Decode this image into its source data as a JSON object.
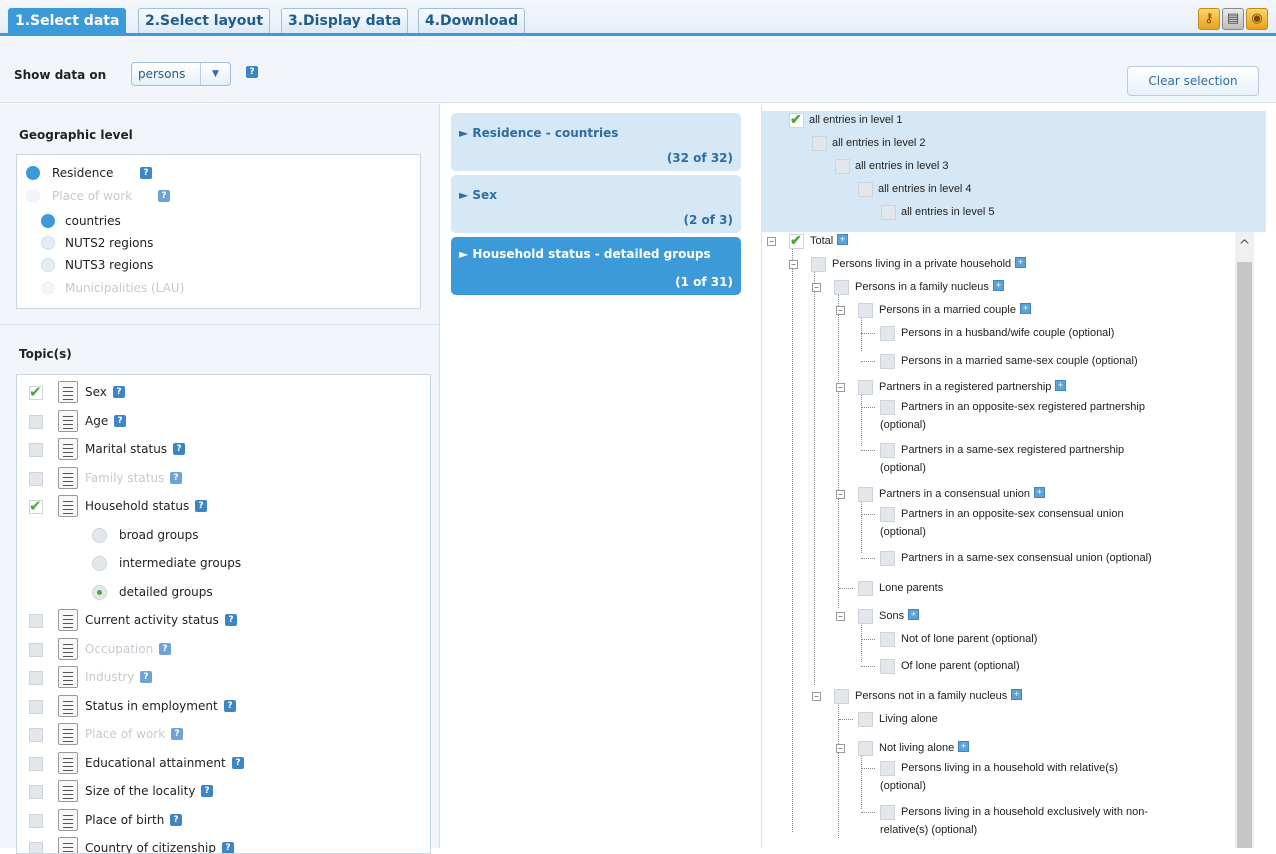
{
  "tabs": [
    {
      "label": "1.Select data",
      "active": true
    },
    {
      "label": "2.Select layout",
      "active": false
    },
    {
      "label": "3.Display data",
      "active": false
    },
    {
      "label": "4.Download",
      "active": false
    }
  ],
  "tool_icons": [
    "key-icon",
    "table-icon",
    "disc-icon"
  ],
  "toolbar": {
    "show_label": "Show data on",
    "select_value": "persons",
    "clear_label": "Clear selection"
  },
  "geo": {
    "title": "Geographic level",
    "items": [
      {
        "label": "Residence",
        "state": "on",
        "help": true
      },
      {
        "label": "Place of work",
        "state": "faded",
        "help": true
      },
      {
        "label": "countries",
        "state": "on",
        "help": false
      },
      {
        "label": "NUTS2 regions",
        "state": "off",
        "help": false
      },
      {
        "label": "NUTS3 regions",
        "state": "off",
        "help": false
      },
      {
        "label": "Municipalities (LAU)",
        "state": "faded",
        "help": false
      }
    ]
  },
  "topics": {
    "title": "Topic(s)",
    "items": [
      {
        "label": "Sex",
        "checked": true,
        "faded": false
      },
      {
        "label": "Age",
        "checked": false,
        "faded": false
      },
      {
        "label": "Marital status",
        "checked": false,
        "faded": false
      },
      {
        "label": "Family status",
        "checked": false,
        "faded": true
      },
      {
        "label": "Household status",
        "checked": true,
        "faded": false
      },
      {
        "label": "Current activity status",
        "checked": false,
        "faded": false
      },
      {
        "label": "Occupation",
        "checked": false,
        "faded": true
      },
      {
        "label": "Industry",
        "checked": false,
        "faded": true
      },
      {
        "label": "Status in employment",
        "checked": false,
        "faded": false
      },
      {
        "label": "Place of work",
        "checked": false,
        "faded": true
      },
      {
        "label": "Educational attainment",
        "checked": false,
        "faded": false
      },
      {
        "label": "Size of the locality",
        "checked": false,
        "faded": false
      },
      {
        "label": "Place of birth",
        "checked": false,
        "faded": false
      },
      {
        "label": "Country of citizenship",
        "checked": false,
        "faded": false
      }
    ],
    "sub_options": [
      {
        "label": "broad groups",
        "on": false
      },
      {
        "label": "intermediate groups",
        "on": false
      },
      {
        "label": "detailed groups",
        "on": true
      }
    ]
  },
  "middle": {
    "cards": [
      {
        "title": "► Residence - countries",
        "count": "(32 of 32)",
        "active": false
      },
      {
        "title": "► Sex",
        "count": "(2 of 3)",
        "active": false
      },
      {
        "title": "► Household status - detailed groups",
        "count": "(1 of 31)",
        "active": true
      }
    ]
  },
  "levels": [
    {
      "label": "all entries in level 1",
      "checked": true
    },
    {
      "label": "all entries in level 2",
      "checked": false
    },
    {
      "label": "all entries in level 3",
      "checked": false
    },
    {
      "label": "all entries in level 4",
      "checked": false
    },
    {
      "label": "all entries in level 5",
      "checked": false
    }
  ],
  "tree": [
    {
      "label": "Total",
      "checked": true,
      "plus": true
    },
    {
      "label": "Persons living in a private household",
      "plus": true
    },
    {
      "label": "Persons in a family nucleus",
      "plus": true
    },
    {
      "label": "Persons in a married couple",
      "plus": true
    },
    {
      "label": "Persons in a husband/wife couple (optional)"
    },
    {
      "label": "Persons in a married same-sex couple (optional)"
    },
    {
      "label": "Partners in a registered partnership",
      "plus": true
    },
    {
      "label": "Partners in an opposite-sex registered partnership",
      "line2": "(optional)"
    },
    {
      "label": "Partners in a same-sex registered partnership",
      "line2": "(optional)"
    },
    {
      "label": "Partners in a consensual union",
      "plus": true
    },
    {
      "label": "Partners in an opposite-sex consensual union",
      "line2": "(optional)"
    },
    {
      "label": "Partners in a same-sex consensual union (optional)"
    },
    {
      "label": "Lone parents"
    },
    {
      "label": "Sons",
      "plus": true
    },
    {
      "label": "Not of lone parent (optional)"
    },
    {
      "label": "Of lone parent (optional)"
    },
    {
      "label": "Persons not in a family nucleus",
      "plus": true
    },
    {
      "label": "Living alone"
    },
    {
      "label": "Not living alone",
      "plus": true
    },
    {
      "label": "Persons living in a household with relative(s)",
      "line2": "(optional)"
    },
    {
      "label": "Persons living in a household exclusively with non-",
      "line2": "relative(s) (optional)"
    }
  ],
  "glyphs": {
    "check": "✔",
    "help": "?",
    "plus": "+",
    "minus": "−",
    "arrow_down": "▼",
    "scroll_up": "^",
    "key": "⚷",
    "table": "▤",
    "disc": "◉"
  },
  "colors": {
    "accent": "#3d9ad8",
    "check": "#4aa83a",
    "card_bg": "#d6e8f6",
    "panel_bg": "#f2f6fb"
  }
}
